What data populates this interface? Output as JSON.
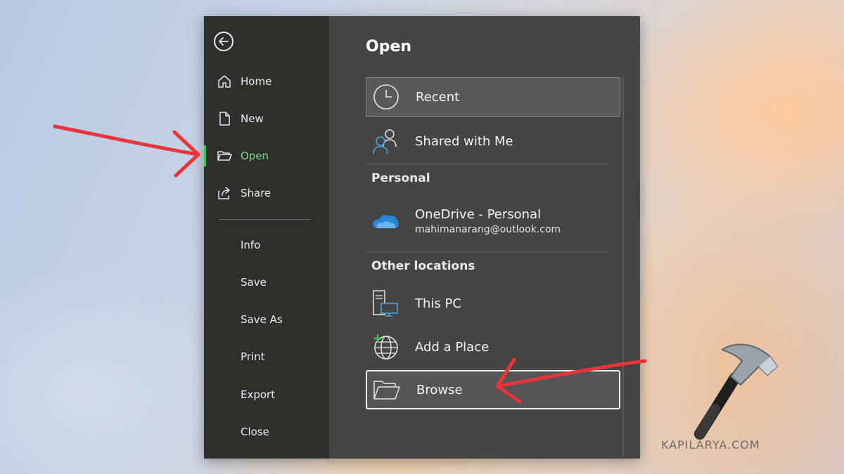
{
  "sidebar": {
    "items": [
      {
        "label": "Home",
        "icon": "home-icon"
      },
      {
        "label": "New",
        "icon": "new-document-icon"
      },
      {
        "label": "Open",
        "icon": "folder-open-icon"
      },
      {
        "label": "Share",
        "icon": "share-icon"
      }
    ],
    "plain_items": [
      "Info",
      "Save",
      "Save As",
      "Print",
      "Export",
      "Close"
    ],
    "active_color": "#46c45a"
  },
  "main": {
    "title": "Open",
    "recent_label": "Recent",
    "shared_label": "Shared with Me",
    "personal_header": "Personal",
    "onedrive_label": "OneDrive - Personal",
    "onedrive_email": "mahimanarang@outlook.com",
    "other_header": "Other locations",
    "thispc_label": "This PC",
    "addplace_label": "Add a Place",
    "browse_label": "Browse"
  },
  "annotation": {
    "arrow_color": "#e8343a"
  },
  "watermark": {
    "text": "KAPILARYA.COM"
  }
}
